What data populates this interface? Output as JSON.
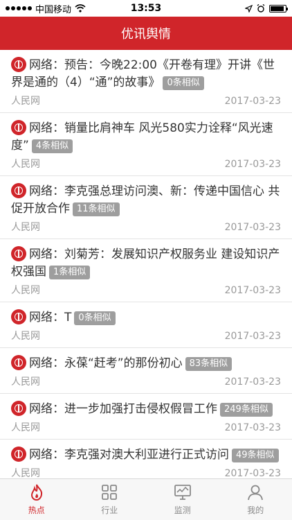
{
  "status_bar": {
    "carrier": "中国移动",
    "time": "13:53",
    "battery_level": 0.9
  },
  "header": {
    "title": "优讯舆情"
  },
  "news": [
    {
      "title": "网络：预告：今晚22:00《开卷有理》开讲《世界是通的（4）“通”的故事》",
      "badge": "0条相似",
      "source": "人民网",
      "date": "2017-03-23"
    },
    {
      "title": "网络：销量比肩神车 风光580实力诠释“风光速度”",
      "badge": "4条相似",
      "source": "人民网",
      "date": "2017-03-23"
    },
    {
      "title": "网络：李克强总理访问澳、新：传递中国信心 共促开放合作",
      "badge": "11条相似",
      "source": "人民网",
      "date": "2017-03-23"
    },
    {
      "title": "网络：刘菊芳：发展知识产权服务业 建设知识产权强国",
      "badge": "1条相似",
      "source": "人民网",
      "date": "2017-03-23"
    },
    {
      "title": "网络：T",
      "badge": "0条相似",
      "source": "人民网",
      "date": "2017-03-23"
    },
    {
      "title": "网络：永葆“赶考”的那份初心",
      "badge": "83条相似",
      "source": "人民网",
      "date": "2017-03-23"
    },
    {
      "title": "网络：进一步加强打击侵权假冒工作",
      "badge": "249条相似",
      "source": "人民网",
      "date": "2017-03-23"
    },
    {
      "title": "网络：李克强对澳大利亚进行正式访问",
      "badge": "49条相似",
      "source": "人民网",
      "date": "2017-03-23"
    }
  ],
  "tabs": [
    {
      "label": "热点",
      "icon": "flame-icon",
      "active": true
    },
    {
      "label": "行业",
      "icon": "grid-icon",
      "active": false
    },
    {
      "label": "监测",
      "icon": "monitor-icon",
      "active": false
    },
    {
      "label": "我的",
      "icon": "person-icon",
      "active": false
    }
  ],
  "colors": {
    "brand": "#d0252a",
    "badge": "#9e9e9e"
  }
}
